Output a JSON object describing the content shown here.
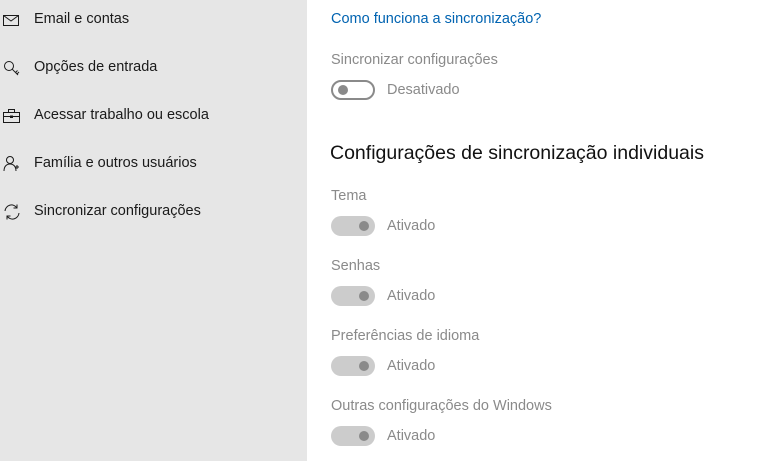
{
  "sidebar": {
    "items": [
      {
        "label": "Email e contas",
        "icon": "mail-icon"
      },
      {
        "label": "Opções de entrada",
        "icon": "key-icon"
      },
      {
        "label": "Acessar trabalho ou escola",
        "icon": "briefcase-icon"
      },
      {
        "label": "Família e outros usuários",
        "icon": "person-icon"
      },
      {
        "label": "Sincronizar configurações",
        "icon": "sync-icon"
      }
    ]
  },
  "main": {
    "help_link": "Como funciona a sincronização?",
    "sync_settings": {
      "label": "Sincronizar configurações",
      "state": "Desativado"
    },
    "individual_heading": "Configurações de sincronização individuais",
    "individual_settings": [
      {
        "label": "Tema",
        "state": "Ativado"
      },
      {
        "label": "Senhas",
        "state": "Ativado"
      },
      {
        "label": "Preferências de idioma",
        "state": "Ativado"
      },
      {
        "label": "Outras configurações do Windows",
        "state": "Ativado"
      }
    ]
  },
  "colors": {
    "sidebar_bg": "#e6e6e6",
    "link": "#0063b1",
    "disabled_text": "#8a8a8a",
    "disabled_toggle_fill": "#cccccc"
  }
}
